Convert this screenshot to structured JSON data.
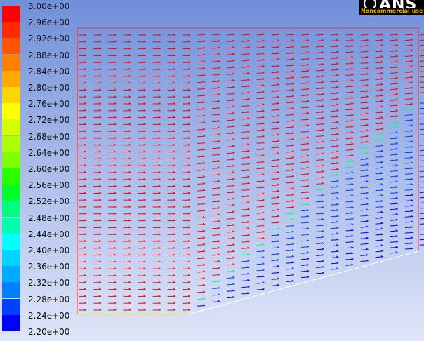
{
  "legend": {
    "labels": [
      "3.00e+00",
      "2.96e+00",
      "2.92e+00",
      "2.88e+00",
      "2.84e+00",
      "2.80e+00",
      "2.76e+00",
      "2.72e+00",
      "2.68e+00",
      "2.64e+00",
      "2.60e+00",
      "2.56e+00",
      "2.52e+00",
      "2.48e+00",
      "2.44e+00",
      "2.40e+00",
      "2.36e+00",
      "2.32e+00",
      "2.28e+00",
      "2.24e+00",
      "2.20e+00"
    ],
    "colors": [
      "#ff0000",
      "#ff2a00",
      "#ff5500",
      "#ff8000",
      "#ffaa00",
      "#ffd400",
      "#ffff00",
      "#d4ff00",
      "#aaff00",
      "#80ff00",
      "#2aff00",
      "#00ff2a",
      "#00ff80",
      "#00ffaa",
      "#00ffff",
      "#00d4ff",
      "#00aaff",
      "#0080ff",
      "#0040ff",
      "#0000ff"
    ]
  },
  "logo": {
    "text": "ANS",
    "subtitle": "Noncommercial use"
  },
  "chart_data": {
    "type": "vector",
    "vmin": 2.2,
    "vmax": 3.0,
    "rows": 41,
    "cols": 24
  }
}
